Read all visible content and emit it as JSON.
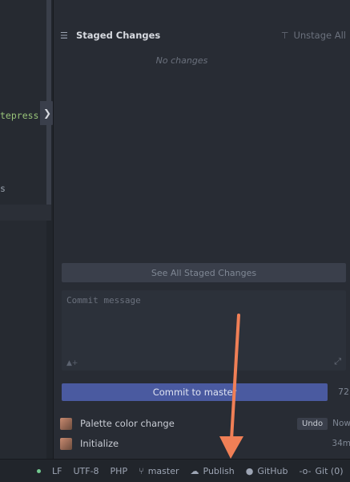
{
  "editor": {
    "code_line_1": "tepress",
    "code_line_2": "s"
  },
  "git_panel": {
    "staged_title": "Staged Changes",
    "unstage_all": "Unstage All",
    "no_changes": "No changes",
    "see_all_staged": "See All Staged Changes",
    "commit_placeholder": "Commit message",
    "commit_button": "Commit to master",
    "char_count": "72",
    "recent_commits": [
      {
        "message": "Palette color change",
        "action": "Undo",
        "time": "Now"
      },
      {
        "message": "Initialize",
        "time": "34m"
      }
    ]
  },
  "status_bar": {
    "line_ending": "LF",
    "encoding": "UTF-8",
    "grammar": "PHP",
    "branch": "master",
    "publish": "Publish",
    "github": "GitHub",
    "git": "Git (0)"
  },
  "colors": {
    "accent": "#4a5aa0",
    "annotation_arrow": "#f07f56"
  }
}
